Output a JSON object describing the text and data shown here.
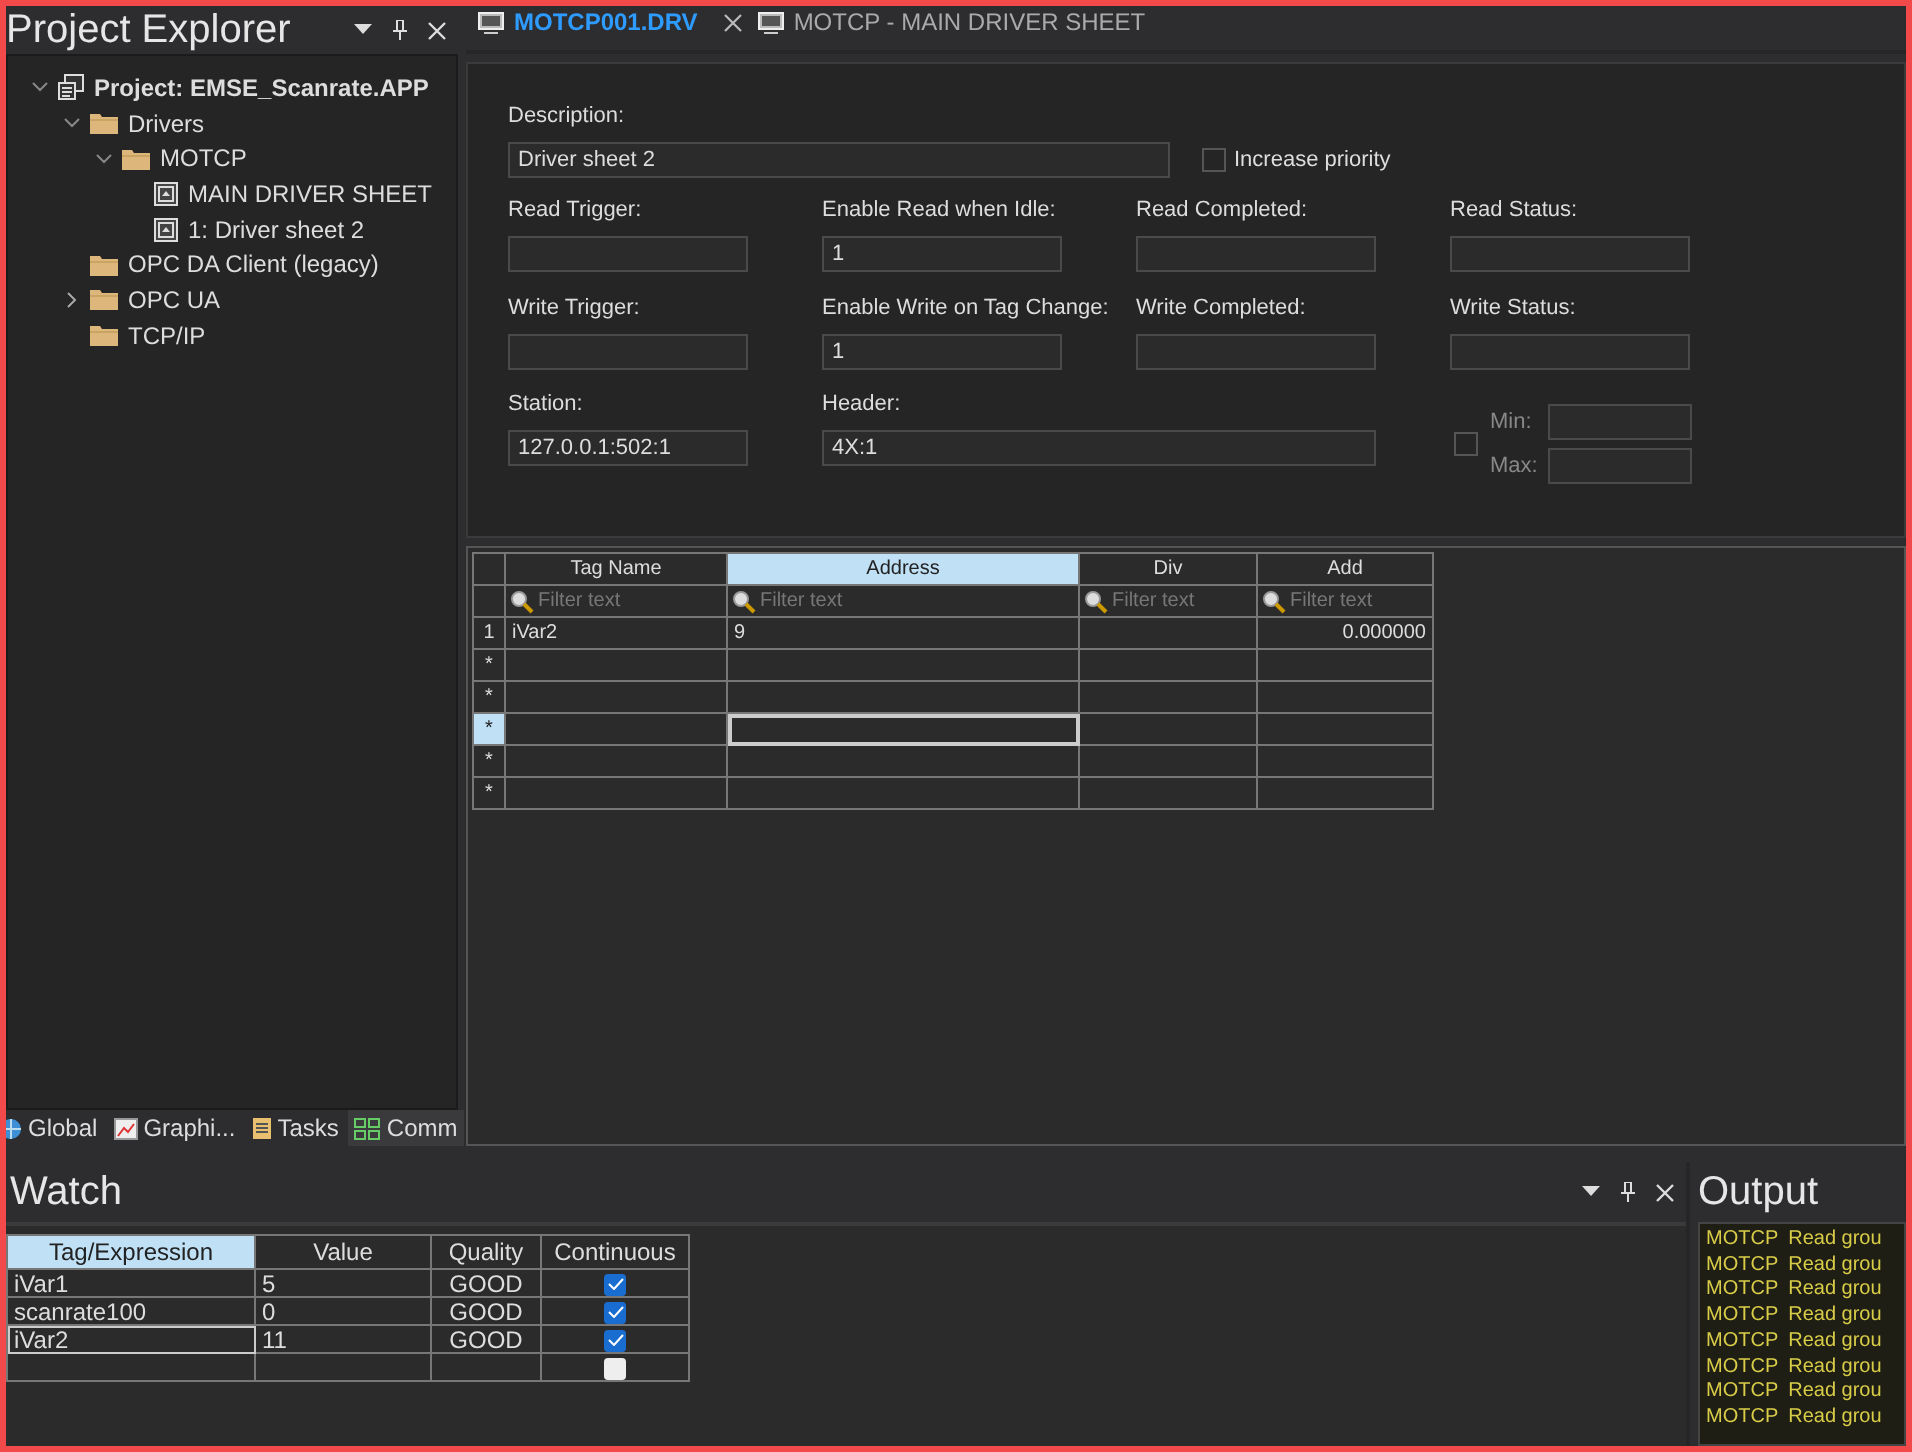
{
  "project_explorer": {
    "title": "Project Explorer",
    "tree": [
      {
        "label": "Project: EMSE_Scanrate.APP",
        "kind": "project",
        "expanded": true,
        "children": [
          {
            "label": "Drivers",
            "kind": "folder",
            "expanded": true,
            "children": [
              {
                "label": "MOTCP",
                "kind": "folder",
                "expanded": true,
                "children": [
                  {
                    "label": "MAIN DRIVER SHEET",
                    "kind": "sheet"
                  },
                  {
                    "label": "1: Driver sheet 2",
                    "kind": "sheet"
                  }
                ]
              }
            ]
          },
          {
            "label": "OPC DA Client (legacy)",
            "kind": "folder"
          },
          {
            "label": "OPC UA",
            "kind": "folder",
            "expanded": false
          },
          {
            "label": "TCP/IP",
            "kind": "folder"
          }
        ]
      }
    ],
    "bottom_tabs": [
      {
        "label": "Global",
        "kind": "global",
        "selected": false
      },
      {
        "label": "Graphi...",
        "kind": "graphics",
        "selected": false
      },
      {
        "label": "Tasks",
        "kind": "tasks",
        "selected": false
      },
      {
        "label": "Comm",
        "kind": "comm",
        "selected": true
      }
    ]
  },
  "editor": {
    "tabs": [
      {
        "label": "MOTCP001.DRV",
        "selected": true,
        "closable": true
      },
      {
        "label": "MOTCP - MAIN DRIVER SHEET",
        "selected": false,
        "closable": false
      }
    ],
    "description": {
      "label": "Description:",
      "value": "Driver sheet 2"
    },
    "increase_priority": {
      "label": "Increase priority",
      "checked": false
    },
    "fields": [
      {
        "label": "Read Trigger:"
      },
      {
        "label": "Enable Read when Idle:",
        "value": "1"
      },
      {
        "label": "Read Completed:"
      },
      {
        "label": "Read Status:"
      },
      {
        "label": "Write Trigger:"
      },
      {
        "label": "Enable Write on Tag Change:",
        "value": "1"
      },
      {
        "label": "Write Completed:"
      },
      {
        "label": "Write Status:"
      }
    ],
    "station": {
      "label": "Station:",
      "value": "127.0.0.1:502:1"
    },
    "header": {
      "label": "Header:",
      "value": "4X:1"
    },
    "range": {
      "checked": false,
      "min_label": "Min:",
      "max_label": "Max:"
    },
    "table": {
      "columns": [
        {
          "label": "Tag Name",
          "selected": false,
          "filter_placeholder": "Filter text"
        },
        {
          "label": "Address",
          "selected": true,
          "filter_placeholder": "Filter text"
        },
        {
          "label": "Div",
          "selected": false,
          "filter_placeholder": "Filter text"
        },
        {
          "label": "Add",
          "selected": false,
          "filter_placeholder": "Filter text"
        }
      ],
      "rows": [
        {
          "marker": "1",
          "selected": false,
          "cells": [
            "iVar2",
            "9",
            null,
            "0.000000"
          ]
        },
        {
          "marker": "*",
          "selected": false
        },
        {
          "marker": "*",
          "selected": false
        },
        {
          "marker": "*",
          "selected": true
        },
        {
          "marker": "*",
          "selected": false
        },
        {
          "marker": "*",
          "selected": false
        }
      ]
    }
  },
  "watch": {
    "title": "Watch",
    "columns": [
      {
        "label": "Tag/Expression",
        "selected": true
      },
      {
        "label": "Value",
        "selected": false
      },
      {
        "label": "Quality",
        "selected": false
      },
      {
        "label": "Continuous",
        "selected": false
      }
    ],
    "rows": [
      {
        "tag": "iVar1",
        "value": "5",
        "quality": "GOOD",
        "continuous": true,
        "selected": false
      },
      {
        "tag": "scanrate100",
        "value": "0",
        "quality": "GOOD",
        "continuous": true,
        "selected": false
      },
      {
        "tag": "iVar2",
        "value": "11",
        "quality": "GOOD",
        "continuous": true,
        "selected": true
      },
      {
        "continuous": false,
        "selected": false
      }
    ]
  },
  "output": {
    "title": "Output",
    "lines": [
      {
        "source": "MOTCP",
        "message": "Read grou"
      },
      {
        "source": "MOTCP",
        "message": "Read grou"
      },
      {
        "source": "MOTCP",
        "message": "Read grou"
      },
      {
        "source": "MOTCP",
        "message": "Read grou"
      },
      {
        "source": "MOTCP",
        "message": "Read grou"
      },
      {
        "source": "MOTCP",
        "message": "Read grou"
      },
      {
        "source": "MOTCP",
        "message": "Read grou"
      },
      {
        "source": "MOTCP",
        "message": "Read grou"
      }
    ]
  }
}
